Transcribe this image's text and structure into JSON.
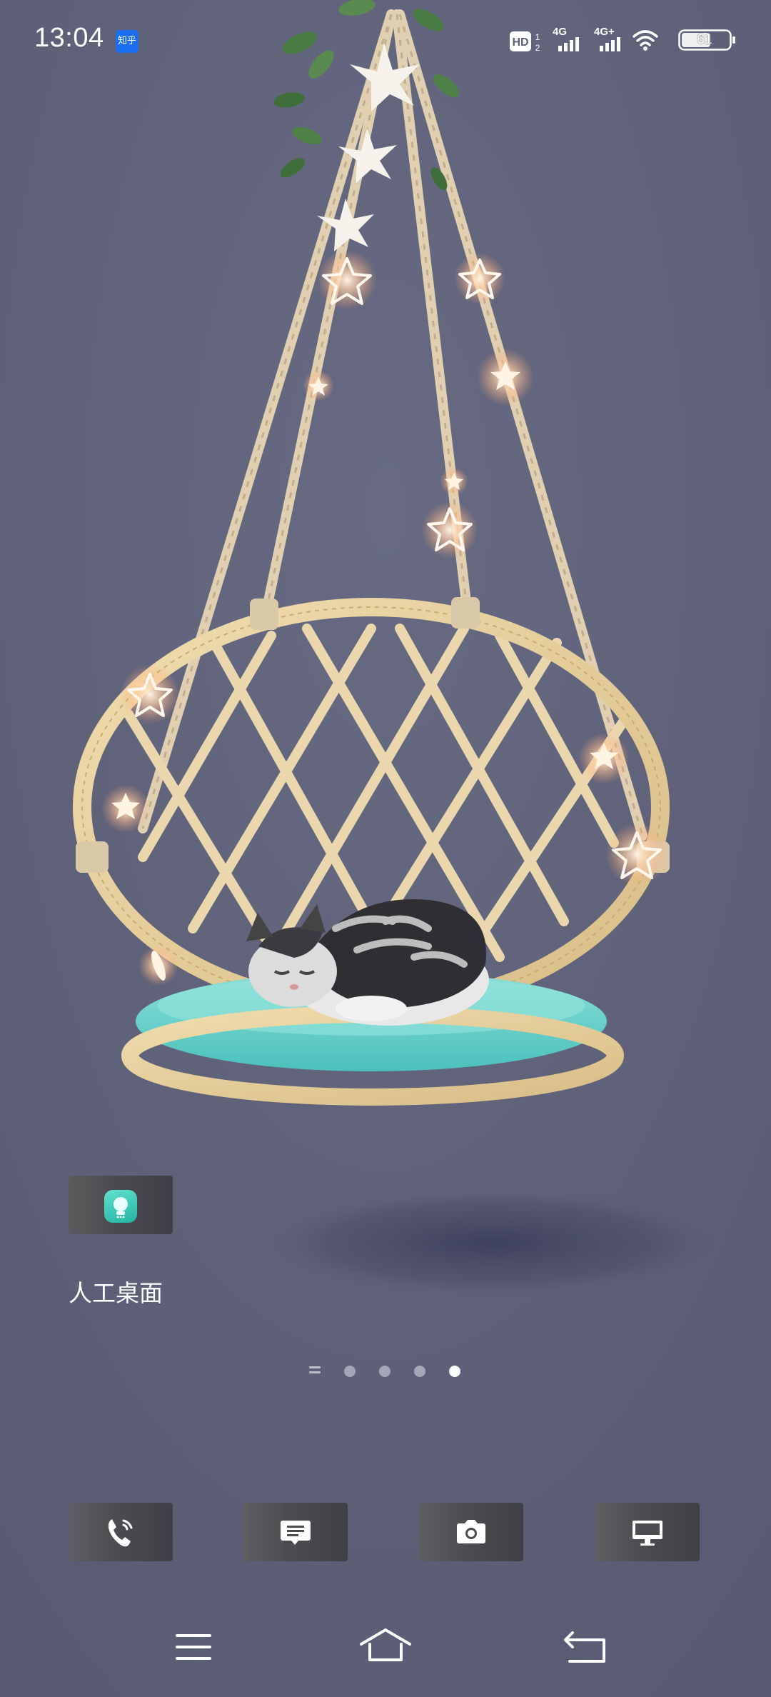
{
  "status_bar": {
    "time": "13:04",
    "notification_app_icon": "zhihu-icon",
    "notification_app_text": "知乎",
    "hd_label": "HD",
    "hd_sim_numbers": "1 2",
    "sim1_network": "4G",
    "sim2_network": "4G+",
    "wifi_icon": "wifi-icon",
    "battery_level": "61"
  },
  "wallpaper": {
    "description_icon": "hanging-chair-cat-wallpaper",
    "background_color": "#5d5f76"
  },
  "widget": {
    "icon": "ai-assistant-icon",
    "label": "人工桌面"
  },
  "page_indicator": {
    "icon": "page-list-icon",
    "page_count": 4,
    "active_index": 3
  },
  "dock": {
    "items": [
      {
        "icon": "phone-icon"
      },
      {
        "icon": "messages-icon"
      },
      {
        "icon": "camera-icon"
      },
      {
        "icon": "monitor-icon"
      }
    ]
  },
  "nav_bar": {
    "menu_icon": "menu-icon",
    "home_icon": "home-icon",
    "back_icon": "back-icon"
  },
  "colors": {
    "accent_widget": "#2ec4b0",
    "notif_icon": "#1a6ef0"
  }
}
